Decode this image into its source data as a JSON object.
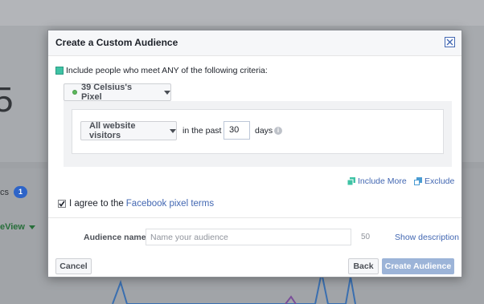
{
  "background": {
    "big_number": "5",
    "label_fragment": "cs",
    "badge_count": "1",
    "view_fragment": "eView"
  },
  "dialog": {
    "title": "Create a Custom Audience",
    "close_icon": "close-icon",
    "criteria_text": "Include people who meet ANY of the following criteria:",
    "pixel_selector": "39 Celsius's Pixel",
    "rule": {
      "visitors_option": "All website visitors",
      "in_the_past": "in the past",
      "days_value": "30",
      "days_label": "days",
      "info_glyph": "i"
    },
    "include_more": "Include More",
    "exclude": "Exclude",
    "agree_text": "I agree to the",
    "agree_link": "Facebook pixel terms",
    "agree_checked": true,
    "audience_name_label": "Audience name",
    "audience_name_placeholder": "Name your audience",
    "audience_name_value": "",
    "char_limit": "50",
    "show_description": "Show description",
    "buttons": {
      "cancel": "Cancel",
      "back": "Back",
      "create": "Create Audience"
    }
  },
  "colors": {
    "accent": "#4267b2",
    "criteria_square": "#3fc3a5",
    "create_button_disabled": "#9cb4d8",
    "pixel_status": "#5cb85c"
  }
}
